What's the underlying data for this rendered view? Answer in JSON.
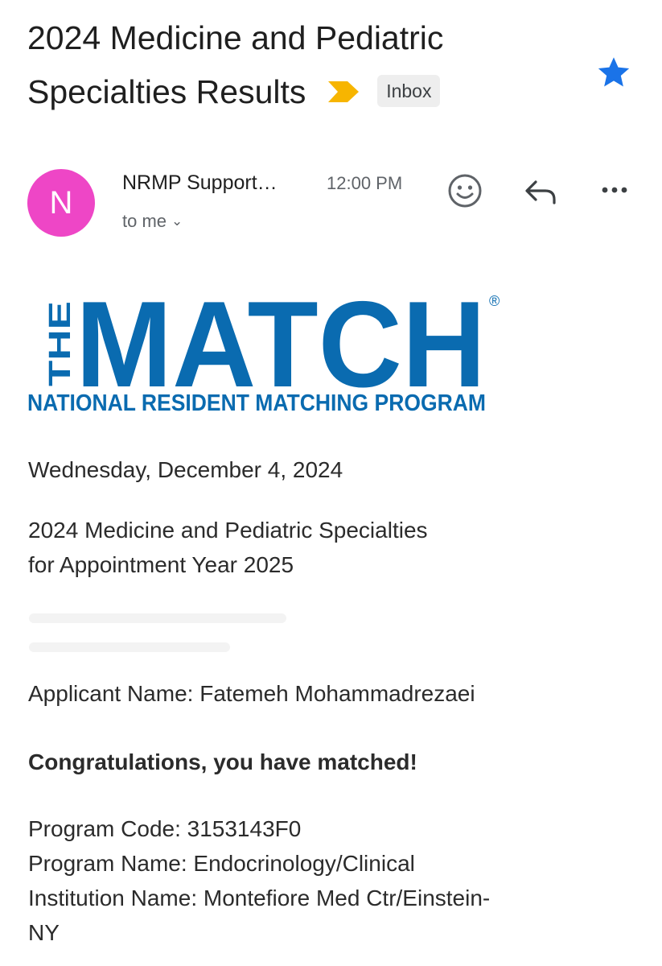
{
  "subject": {
    "line1": "2024 Medicine and Pediatric",
    "line2": "Specialties Results",
    "label": "Inbox"
  },
  "sender": {
    "initial": "N",
    "name": "NRMP Support…",
    "time": "12:00 PM",
    "recipient": "to me"
  },
  "logo": {
    "the": "THE",
    "match": "MATCH",
    "tagline": "NATIONAL RESIDENT MATCHING PROGRAM",
    "registered": "®"
  },
  "body": {
    "date": "Wednesday, December 4, 2024",
    "session_line1": "2024 Medicine and Pediatric Specialties",
    "session_line2": "for Appointment Year 2025",
    "applicant": "Applicant Name: Fatemeh Mohammadrezaei",
    "congrats": "Congratulations, you have matched!",
    "program_code": "Program Code: 3153143F0",
    "program_name": "Program Name: Endocrinology/Clinical",
    "institution_line1": "Institution Name: Montefiore Med Ctr/Einstein-",
    "institution_line2": "NY"
  },
  "colors": {
    "star": "#1a73e8",
    "importance": "#f7b500",
    "avatar": "#ee46c6",
    "logo_blue": "#0a6bb0"
  },
  "icons": [
    "star-icon",
    "importance-marker-icon",
    "emoji-icon",
    "reply-icon",
    "more-icon",
    "chevron-down-icon"
  ]
}
